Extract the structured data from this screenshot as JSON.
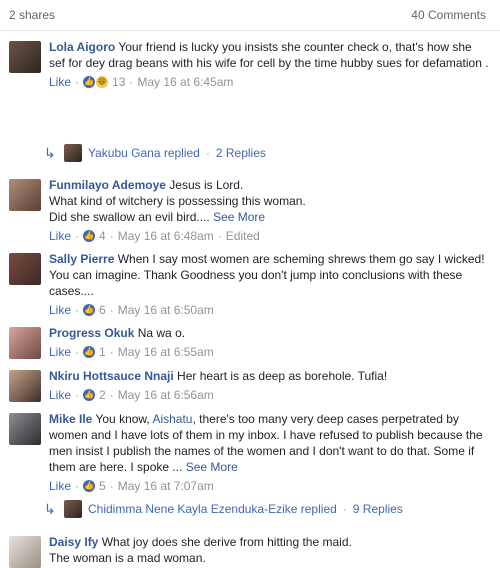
{
  "header": {
    "shares": "2 shares",
    "comments": "40 Comments"
  },
  "comments": [
    {
      "name": "Lola Aigoro",
      "text": "Your friend is lucky you insists she counter check o, that's how she sef for dey drag beans with his wife for cell by the time hubby sues for defamation .",
      "like": "Like",
      "reactions": "13",
      "time": "May 16 at 6:45am",
      "reply_thread": {
        "replied_by": "Yakubu Gana replied",
        "count": "2 Replies"
      }
    },
    {
      "name": "Funmilayo Ademoye",
      "text": "Jesus is Lord.",
      "text2": "What kind of witchery is possessing this woman.",
      "text3": "Did she swallow an evil bird....",
      "see_more": "See More",
      "like": "Like",
      "reactions": "4",
      "time": "May 16 at 6:48am",
      "edited": "Edited"
    },
    {
      "name": "Sally Pierre",
      "text": "When I say most women are scheming shrews them go say I wicked! You can imagine. Thank Goodness you don't jump into conclusions with these cases....",
      "like": "Like",
      "reactions": "6",
      "time": "May 16 at 6:50am"
    },
    {
      "name": "Progress Okuk",
      "text": "Na wa o.",
      "like": "Like",
      "reactions": "1",
      "time": "May 16 at 6:55am"
    },
    {
      "name": "Nkiru Hottsauce Nnaji",
      "text": "Her heart is as deep as borehole. Tufia!",
      "like": "Like",
      "reactions": "2",
      "time": "May 16 at 6:56am"
    },
    {
      "name": "Mike Ile",
      "text_prefix": "You know,",
      "mention": "Aishatu",
      "text": ", there's too many very deep cases perpetrated by women and I have lots of them in my inbox. I have refused to publish because the men insist I publish the names of the women and I don't want to do that. Some if them are here. I spoke ...",
      "see_more": "See More",
      "like": "Like",
      "reactions": "5",
      "time": "May 16 at 7:07am",
      "reply_thread": {
        "replied_by": "Chidimma Nene Kayla Ezenduka-Ezike replied",
        "count": "9 Replies"
      }
    },
    {
      "name": "Daisy Ify",
      "text": "What joy does she derive from hitting the maid.",
      "text2": "The woman is a mad woman."
    }
  ],
  "icons": {
    "reply": "reply-arrow-icon",
    "like_reaction": "thumbs-up-icon",
    "haha_reaction": "haha-icon"
  },
  "colors": {
    "link": "#365899",
    "meta": "#90949c",
    "accent": "#4267b2"
  }
}
